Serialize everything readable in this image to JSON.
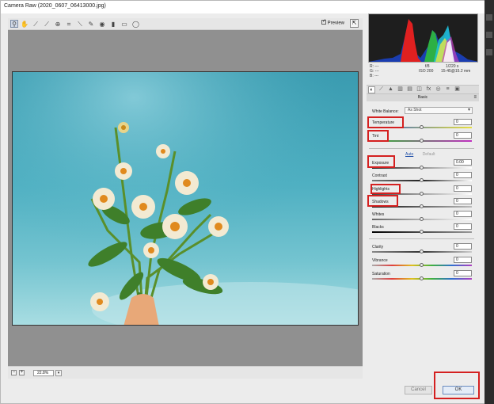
{
  "window": {
    "title": "Camera Raw (2020_0607_06413000.jpg)"
  },
  "toolbar": {
    "tools": [
      "zoom-icon",
      "hand-icon",
      "white-balance-icon",
      "color-sampler-icon",
      "targeted-adjustment-icon",
      "crop-icon",
      "straighten-icon",
      "spot-removal-icon",
      "red-eye-icon",
      "adjustment-brush-icon",
      "graduated-filter-icon",
      "radial-filter-icon"
    ],
    "preview_label": "Preview"
  },
  "zoom": {
    "minus": "−",
    "plus": "+",
    "value": "22.8%"
  },
  "info": {
    "r_label": "R:",
    "g_label": "G:",
    "b_label": "B:",
    "r_value": "---",
    "g_value": "---",
    "b_value": "---",
    "aperture": "f/8",
    "shutter": "1/220 s",
    "iso": "ISO 200",
    "lens": "15-45@15.2 mm"
  },
  "panel": {
    "title": "Basic",
    "white_balance_label": "White Balance:",
    "white_balance_value": "As Shot",
    "auto_label": "Auto",
    "default_label": "Default"
  },
  "sliders": {
    "temperature": {
      "label": "Temperature",
      "value": "0",
      "level": 0.5
    },
    "tint": {
      "label": "Tint",
      "value": "0",
      "level": 0.5
    },
    "exposure": {
      "label": "Exposure",
      "value": "0.00",
      "level": 0.5
    },
    "contrast": {
      "label": "Contrast",
      "value": "0",
      "level": 0.5
    },
    "highlights": {
      "label": "Highlights",
      "value": "0",
      "level": 0.5
    },
    "shadows": {
      "label": "Shadows",
      "value": "0",
      "level": 0.5
    },
    "whites": {
      "label": "Whites",
      "value": "0",
      "level": 0.5
    },
    "blacks": {
      "label": "Blacks",
      "value": "0",
      "level": 0.5
    },
    "clarity": {
      "label": "Clarity",
      "value": "0",
      "level": 0.5
    },
    "vibrance": {
      "label": "Vibrance",
      "value": "0",
      "level": 0.5
    },
    "saturation": {
      "label": "Saturation",
      "value": "0",
      "level": 0.5
    }
  },
  "buttons": {
    "cancel": "Cancel",
    "ok": "OK"
  },
  "colors": {
    "highlight_red": "#d42020",
    "sky": "#4fb0c2"
  }
}
